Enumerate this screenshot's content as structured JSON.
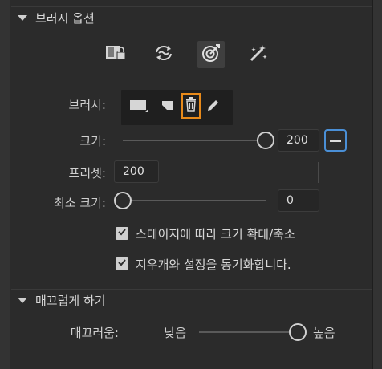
{
  "sections": {
    "brush_options": {
      "title": "브러시 옵션"
    },
    "smoothing": {
      "title": "매끄럽게 하기"
    }
  },
  "modes": [
    {
      "name": "locked-layer-mode",
      "icon": "layer-lock-icon",
      "selected": false
    },
    {
      "name": "sync-mode",
      "icon": "sync-icon",
      "selected": false
    },
    {
      "name": "target-mode",
      "icon": "target-icon",
      "selected": true
    },
    {
      "name": "magic-mode",
      "icon": "magic-wand-icon",
      "selected": false
    }
  ],
  "brush": {
    "label": "브러시:",
    "tools": [
      "brush-preset-icon",
      "stamp-icon",
      "trash-icon",
      "pencil-icon"
    ]
  },
  "size": {
    "label": "크기:",
    "value": "200",
    "slider_fraction": 1.0
  },
  "preset": {
    "label": "프리셋:",
    "value": "200"
  },
  "min_size": {
    "label": "최소 크기:",
    "value": "0",
    "slider_fraction": 0.0
  },
  "options": {
    "scale_with_brush": {
      "label": "스테이지에 따라 크기 확대/축소",
      "checked": true
    },
    "sync_eraser": {
      "label": "지우개와 설정을 동기화합니다.",
      "checked": true
    }
  },
  "smoothing": {
    "label": "매끄러움:",
    "low_label": "낮음",
    "high_label": "높음",
    "slider_fraction": 1.0
  },
  "colors": {
    "accent": "#e88a1a",
    "focus": "#4a8fd6",
    "panel": "#2b2b2b"
  }
}
